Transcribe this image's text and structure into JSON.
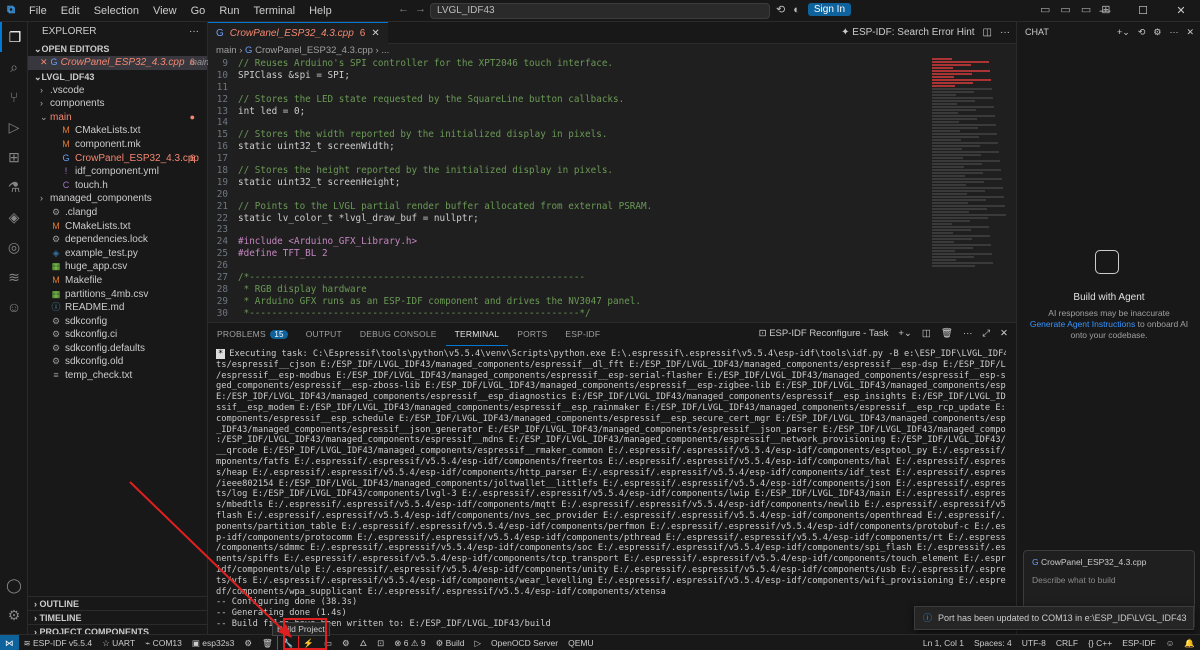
{
  "titlebar": {
    "menu": [
      "File",
      "Edit",
      "Selection",
      "View",
      "Go",
      "Run",
      "Terminal",
      "Help"
    ],
    "search": "LVGL_IDF43",
    "signin": "Sign In"
  },
  "explorer": {
    "header": "EXPLORER",
    "open_editors": "OPEN EDITORS",
    "open_file": "CrowPanel_ESP32_4.3.cpp",
    "open_file_branch": "main",
    "open_file_count": "6",
    "project": "LVGL_IDF43",
    "tree": [
      {
        "name": ".vscode",
        "type": "folder",
        "indent": 1
      },
      {
        "name": "components",
        "type": "folder",
        "indent": 1
      },
      {
        "name": "main",
        "type": "folder-open",
        "indent": 1,
        "status": "err"
      },
      {
        "name": "CMakeLists.txt",
        "type": "cmake",
        "indent": 2
      },
      {
        "name": "component.mk",
        "type": "mk",
        "indent": 2
      },
      {
        "name": "CrowPanel_ESP32_4.3.cpp",
        "type": "cpp",
        "indent": 2,
        "status": "err",
        "badge": "6"
      },
      {
        "name": "idf_component.yml",
        "type": "yml",
        "indent": 2
      },
      {
        "name": "touch.h",
        "type": "h",
        "indent": 2
      },
      {
        "name": "managed_components",
        "type": "folder",
        "indent": 1
      },
      {
        "name": ".clangd",
        "type": "file",
        "indent": 1
      },
      {
        "name": "CMakeLists.txt",
        "type": "cmake",
        "indent": 1
      },
      {
        "name": "dependencies.lock",
        "type": "file",
        "indent": 1
      },
      {
        "name": "example_test.py",
        "type": "py",
        "indent": 1
      },
      {
        "name": "huge_app.csv",
        "type": "csv",
        "indent": 1
      },
      {
        "name": "Makefile",
        "type": "mk",
        "indent": 1
      },
      {
        "name": "partitions_4mb.csv",
        "type": "csv",
        "indent": 1
      },
      {
        "name": "README.md",
        "type": "md",
        "indent": 1
      },
      {
        "name": "sdkconfig",
        "type": "file",
        "indent": 1
      },
      {
        "name": "sdkconfig.ci",
        "type": "file",
        "indent": 1
      },
      {
        "name": "sdkconfig.defaults",
        "type": "file",
        "indent": 1
      },
      {
        "name": "sdkconfig.old",
        "type": "file",
        "indent": 1
      },
      {
        "name": "temp_check.txt",
        "type": "txt",
        "indent": 1
      }
    ],
    "outline": "OUTLINE",
    "timeline": "TIMELINE",
    "project_components": "PROJECT COMPONENTS"
  },
  "editor": {
    "tab": "CrowPanel_ESP32_4.3.cpp",
    "tab_count": "6",
    "hint": "ESP-IDF: Search Error Hint",
    "breadcrumb": [
      "main",
      "CrowPanel_ESP32_4.3.cpp",
      "..."
    ],
    "lines": [
      {
        "n": "9",
        "t": "// Reuses Arduino's SPI controller for the XPT2046 touch interface.",
        "k": "cmt"
      },
      {
        "n": "10",
        "t": "SPIClass &spi = SPI;",
        "k": ""
      },
      {
        "n": "11",
        "t": "",
        "k": ""
      },
      {
        "n": "12",
        "t": "// Stores the LED state requested by the SquareLine button callbacks.",
        "k": "cmt"
      },
      {
        "n": "13",
        "t": "int led = 0;",
        "k": ""
      },
      {
        "n": "14",
        "t": "",
        "k": ""
      },
      {
        "n": "15",
        "t": "// Stores the width reported by the initialized display in pixels.",
        "k": "cmt"
      },
      {
        "n": "16",
        "t": "static uint32_t screenWidth;",
        "k": ""
      },
      {
        "n": "17",
        "t": "",
        "k": ""
      },
      {
        "n": "18",
        "t": "// Stores the height reported by the initialized display in pixels.",
        "k": "cmt"
      },
      {
        "n": "19",
        "t": "static uint32_t screenHeight;",
        "k": ""
      },
      {
        "n": "20",
        "t": "",
        "k": ""
      },
      {
        "n": "21",
        "t": "// Points to the LVGL partial render buffer allocated from external PSRAM.",
        "k": "cmt"
      },
      {
        "n": "22",
        "t": "static lv_color_t *lvgl_draw_buf = nullptr;",
        "k": ""
      },
      {
        "n": "23",
        "t": "",
        "k": ""
      },
      {
        "n": "24",
        "t": "#include <Arduino_GFX_Library.h>",
        "k": "pp"
      },
      {
        "n": "25",
        "t": "#define TFT_BL 2",
        "k": "pp"
      },
      {
        "n": "26",
        "t": "",
        "k": ""
      },
      {
        "n": "27",
        "t": "/*------------------------------------------------------------",
        "k": "cmt"
      },
      {
        "n": "28",
        "t": " * RGB display hardware",
        "k": "cmt"
      },
      {
        "n": "29",
        "t": " * Arduino GFX runs as an ESP-IDF component and drives the NV3047 panel.",
        "k": "cmt"
      },
      {
        "n": "30",
        "t": " *-----------------------------------------------------------*/",
        "k": "cmt"
      }
    ]
  },
  "panel": {
    "tabs": [
      "PROBLEMS",
      "OUTPUT",
      "DEBUG CONSOLE",
      "TERMINAL",
      "PORTS",
      "ESP-IDF"
    ],
    "problems_count": "15",
    "task": "ESP-IDF Reconfigure - Task",
    "terminal": [
      "Executing task: C:\\Espressif\\tools\\python\\v5.5.4\\venv\\Scripts\\python.exe E:\\.espressif\\.espressif\\v5.5.4\\esp-idf\\tools\\idf.py -B e:\\ESP_IDF\\LVGL_IDF43\\build reconfigure",
      "ts/espressif__cjson E:/ESP_IDF/LVGL_IDF43/managed_components/espressif__dl_fft E:/ESP_IDF/LVGL_IDF43/managed_components/espressif__esp-dsp E:/ESP_IDF/LVGL_IDF43/managed_components",
      "/espressif__esp-modbus E:/ESP_IDF/LVGL_IDF43/managed_components/espressif__esp-serial-flasher E:/ESP_IDF/LVGL_IDF43/managed_components/espressif__esp-sr E:/ESP_IDF/LVGL_IDF43/mana",
      "ged_components/espressif__esp-zboss-lib E:/ESP_IDF/LVGL_IDF43/managed_components/espressif__esp-zigbee-lib E:/ESP_IDF/LVGL_IDF43/managed_components/espressif__esp_diag_data_store",
      "E:/ESP_IDF/LVGL_IDF43/managed_components/espressif__esp_diagnostics E:/ESP_IDF/LVGL_IDF43/managed_components/espressif__esp_insights E:/ESP_IDF/LVGL_IDF43/managed_components/espre",
      "ssif__esp_modem E:/ESP_IDF/LVGL_IDF43/managed_components/espressif__esp_rainmaker E:/ESP_IDF/LVGL_IDF43/managed_components/espressif__esp_rcp_update E:/ESP_IDF/LVGL_IDF43/managed_",
      "components/espressif__esp_schedule E:/ESP_IDF/LVGL_IDF43/managed_components/espressif__esp_secure_cert_mgr E:/ESP_IDF/LVGL_IDF43/managed_components/espressif__jsmn E:/ESP_IDF/LVGL",
      "_IDF43/managed_components/espressif__json_generator E:/ESP_IDF/LVGL_IDF43/managed_components/espressif__json_parser E:/ESP_IDF/LVGL_IDF43/managed_components/espressif__libsodium E",
      ":/ESP_IDF/LVGL_IDF43/managed_components/espressif__mdns E:/ESP_IDF/LVGL_IDF43/managed_components/espressif__network_provisioning E:/ESP_IDF/LVGL_IDF43/managed_components/espressif",
      "__qrcode E:/ESP_IDF/LVGL_IDF43/managed_components/espressif__rmaker_common E:/.espressif/.espressif/v5.5.4/esp-idf/components/esptool_py E:/.espressif/.espressif/v5.5.4/esp-idf/co",
      "mponents/fatfs E:/.espressif/.espressif/v5.5.4/esp-idf/components/freertos E:/.espressif/.espressif/v5.5.4/esp-idf/components/hal E:/.espressif/.espressif/v5.5.4/esp-idf/component",
      "s/heap E:/.espressif/.espressif/v5.5.4/esp-idf/components/http_parser E:/.espressif/.espressif/v5.5.4/esp-idf/components/idf_test E:/.espressif/.espressif/v5.5.4/esp-idf/components",
      "/ieee802154 E:/ESP_IDF/LVGL_IDF43/managed_components/joltwallet__littlefs E:/.espressif/.espressif/v5.5.4/esp-idf/components/json E:/.espressif/.espressif/v5.5.4/esp-idf/componen",
      "ts/log E:/ESP_IDF/LVGL_IDF43/components/lvgl-3 E:/.espressif/.espressif/v5.5.4/esp-idf/components/lwip E:/ESP_IDF/LVGL_IDF43/main E:/.espressif/.espressif/v5.5.4/esp-idf/components",
      "s/mbedtls E:/.espressif/.espressif/v5.5.4/esp-idf/components/mqtt E:/.espressif/.espressif/v5.5.4/esp-idf/components/newlib E:/.espressif/.espressif/v5.5.4/esp-idf/components/nvs_",
      "flash E:/.espressif/.espressif/v5.5.4/esp-idf/components/nvs_sec_provider E:/.espressif/.espressif/v5.5.4/esp-idf/components/openthread E:/.espressif/.espressif/v5.5.4/esp-idf/com",
      "ponents/partition_table E:/.espressif/.espressif/v5.5.4/esp-idf/components/perfmon E:/.espressif/.espressif/v5.5.4/esp-idf/components/protobuf-c E:/.espressif/.espressif/v5.5.4/es",
      "p-idf/components/protocomm E:/.espressif/.espressif/v5.5.4/esp-idf/components/pthread E:/.espressif/.espressif/v5.5.4/esp-idf/components/rt E:/.espressif/.espressif/v5.5.4/esp-idf",
      "/components/sdmmc E:/.espressif/.espressif/v5.5.4/esp-idf/components/soc E:/.espressif/.espressif/v5.5.4/esp-idf/components/spi_flash E:/.espressif/.espressif/v5.5.4/esp-idf/compo",
      "nents/spiffs E:/.espressif/.espressif/v5.5.4/esp-idf/components/tcp_transport E:/.espressif/.espressif/v5.5.4/esp-idf/components/touch_element E:/.espressif/.espressif/v5.5.4/esp-",
      "idf/components/ulp E:/.espressif/.espressif/v5.5.4/esp-idf/components/unity E:/.espressif/.espressif/v5.5.4/esp-idf/components/usb E:/.espressif/.espressif/v5.5.4/esp-idf/componen",
      "ts/vfs E:/.espressif/.espressif/v5.5.4/esp-idf/components/wear_levelling E:/.espressif/.espressif/v5.5.4/esp-idf/components/wifi_provisioning E:/.espressif/.espressif/v5.5.4/esp-i",
      "df/components/wpa_supplicant E:/.espressif/.espressif/v5.5.4/esp-idf/components/xtensa",
      "-- Configuring done (38.3s)",
      "-- Generating done (1.4s)",
      "-- Build files have been written to: E:/ESP_IDF/LVGL_IDF43/build"
    ]
  },
  "chat": {
    "header": "CHAT",
    "title": "Build with Agent",
    "desc_1": "AI responses may be inaccurate",
    "desc_link": "Generate Agent Instructions",
    "desc_2": "to onboard AI onto your codebase.",
    "context_file": "CrowPanel_ESP32_4.3.cpp",
    "placeholder": "Describe what to build"
  },
  "notification": "Port has been updated to COM13 in e:\\ESP_IDF\\LVGL_IDF43",
  "statusbar": {
    "left": [
      "ESP-IDF v5.5.4",
      "UART",
      "COM13",
      "esp32s3"
    ],
    "errors": "6",
    "warnings": "9",
    "build": "Build",
    "openocd": "OpenOCD Server",
    "qemu": "QEMU",
    "right": [
      "Ln 1, Col 1",
      "Spaces: 4",
      "UTF-8",
      "CRLF",
      "{} C++",
      "ESP-IDF"
    ]
  },
  "tooltip": "Build Project",
  "colors": {
    "accent": "#0078d4",
    "error": "#f48771",
    "annotation": "#e02020"
  }
}
